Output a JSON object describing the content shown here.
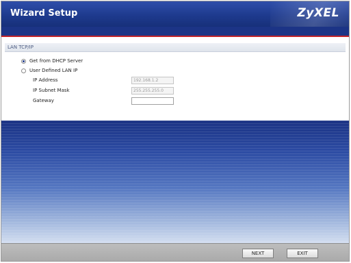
{
  "header": {
    "title": "Wizard Setup",
    "logo": "ZyXEL"
  },
  "section": {
    "title": "LAN TCP/IP"
  },
  "options": {
    "dhcp_label": "Get from DHCP Server",
    "dhcp_selected": true,
    "user_defined_label": "User Defined LAN IP",
    "user_defined_selected": false
  },
  "fields": {
    "ip_address_label": "IP Address",
    "ip_address_value": "192.168.1.2",
    "subnet_mask_label": "IP Subnet Mask",
    "subnet_mask_value": "255.255.255.0",
    "gateway_label": "Gateway",
    "gateway_value": ""
  },
  "footer": {
    "next_label": "NEXT",
    "exit_label": "EXIT"
  },
  "colors": {
    "header_blue": "#1e3a8e",
    "accent_red": "#c3242a"
  }
}
